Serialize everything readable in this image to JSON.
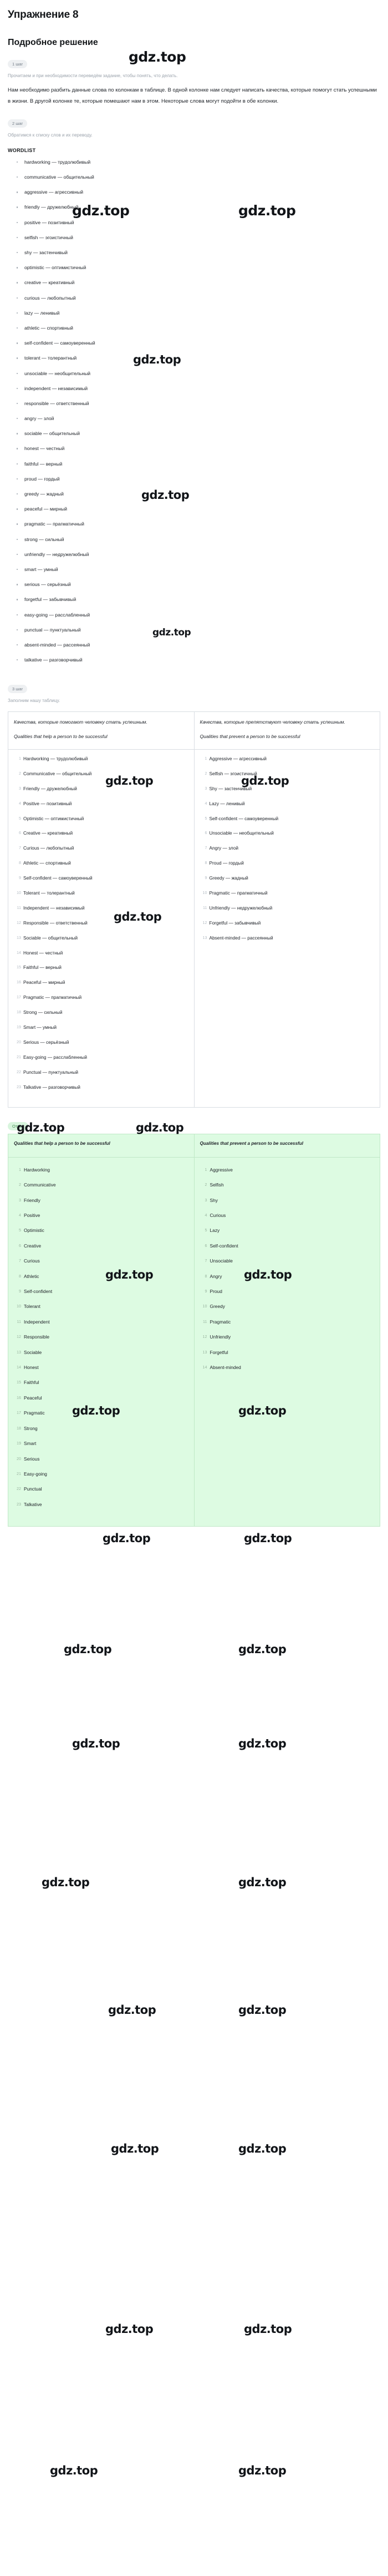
{
  "header": {
    "exercise_title": "Упражнение 8",
    "solution_title": "Подробное решение"
  },
  "steps": [
    {
      "badge": "1 шаг",
      "hint": "Прочитаем и при необходимости переведём задание, чтобы понять, что делать.",
      "paragraph": "Нам необходимо разбить данные слова по колонкам в таблице. В одной колонке нам следует написать качества, которые помогут стать успешными в жизни. В другой колонке те, которые помешают нам в этом. Некоторые слова могут подойти в обе колонки."
    },
    {
      "badge": "2 шаг",
      "hint": "Обратимся к списку слов и их переводу.",
      "wordlist_title": "WORDLIST"
    },
    {
      "badge": "3 шаг",
      "hint": "Заполним нашу таблицу."
    }
  ],
  "wordlist": [
    "hardworking — трудолюбивый",
    "communicative — общительный",
    "aggressive — агрессивный",
    "friendly — дружелюбный",
    "positive — позитивный",
    "selfish — эгоистичный",
    "shy — застенчивый",
    "optimistic — оптимистичный",
    "creative — креативный",
    "curious — любопытный",
    "lazy — ленивый",
    "athletic — спортивный",
    "self-confident — самоуверенный",
    "tolerant — толерантный",
    "unsociable — необщительный",
    "independent — независимый",
    "responsible — ответственный",
    "angry — злой",
    "sociable — общительный",
    "honest — честный",
    "faithful — верный",
    "proud — гордый",
    "greedy — жадный",
    "peaceful — мирный",
    "pragmatic — прагматичный",
    "strong — сильный",
    "unfriendly — недружелюбный",
    "smart — умный",
    "serious — серьёзный",
    "forgetful — забывчивый",
    "easy-going — расслабленный",
    "punctual — пунктуальный",
    "absent-minded — рассеянный",
    "talkative — разговорчивый"
  ],
  "table": {
    "col1_ru": "Качества, которые помогают человеку стать успешным.",
    "col1_en": "Qualities that help a person to be successful",
    "col2_ru": "Качества, которые препятствуют человеку стать успешным.",
    "col2_en": "Qualities that prevent a person to be successful",
    "col1_items": [
      "Hardworking — трудолюбивый",
      "Communicative — общительный",
      "Friendly — дружелюбный",
      "Positive — позитивный",
      "Optimistic — оптимистичный",
      "Creative — креативный",
      "Curious — любопытный",
      "Athletic — спортивный",
      "Self-confident — самоуверенный",
      "Tolerant — толерантный",
      "Independent — независимый",
      "Responsible — ответственный",
      "Sociable — общительный",
      "Honest — честный",
      "Faithful — верный",
      "Peaceful — мирный",
      "Pragmatic — прагматичный",
      "Strong — сильный",
      "Smart — умный",
      "Serious — серьёзный",
      "Easy-going — расслабленный",
      "Punctual — пунктуальный",
      "Talkative — разговорчивый"
    ],
    "col2_items": [
      "Aggressive — агрессивный",
      "Selfish — эгоистичный",
      "Shy — застенчивый",
      "Lazy — ленивый",
      "Self-confident — самоуверенный",
      "Unsociable — необщительный",
      "Angry — злой",
      "Proud — гордый",
      "Greedy — жадный",
      "Pragmatic — прагматичный",
      "Unfriendly — недружелюбный",
      "Forgetful — забывчивый",
      "Absent-minded — рассеянный"
    ]
  },
  "answer": {
    "badge": "Ответ",
    "col1_head": "Qualities that help a person to be successful",
    "col2_head": "Qualities that prevent a person to be successful",
    "col1_items": [
      "Hardworking",
      "Communicative",
      "Friendly",
      "Positive",
      "Optimistic",
      "Creative",
      "Curious",
      "Athletic",
      "Self-confident",
      "Tolerant",
      "Independent",
      "Responsible",
      "Sociable",
      "Honest",
      "Faithful",
      "Peaceful",
      "Pragmatic",
      "Strong",
      "Smart",
      "Serious",
      "Easy-going",
      "Punctual",
      "Talkative"
    ],
    "col2_items": [
      "Aggressive",
      "Selfish",
      "Shy",
      "Curious",
      "Lazy",
      "Self-confident",
      "Unsociable",
      "Angry",
      "Proud",
      "Greedy",
      "Pragmatic",
      "Unfriendly",
      "Forgetful",
      "Absent-minded"
    ]
  },
  "watermark": {
    "text": "gdz.top",
    "color": "#111418"
  }
}
